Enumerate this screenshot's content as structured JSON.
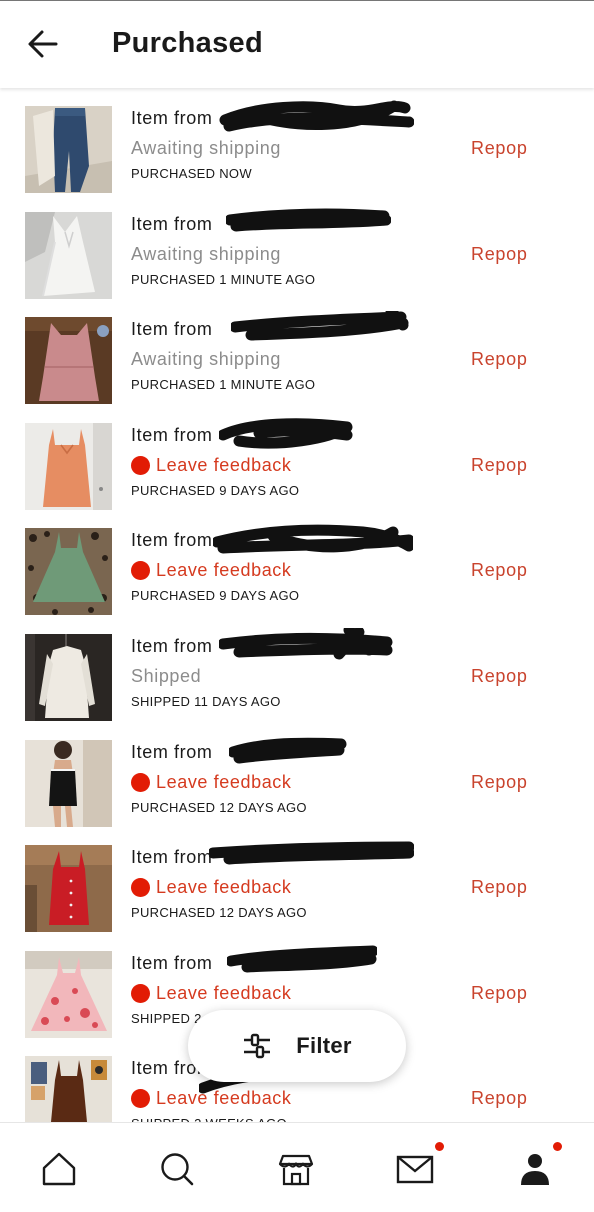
{
  "header": {
    "title": "Purchased",
    "back_icon": "arrow-left-icon"
  },
  "colors": {
    "accent_red": "#d53a1f",
    "repop_red": "#c9432d",
    "status_gray": "#8c8c8c",
    "badge_red": "#e21c05"
  },
  "items": [
    {
      "seller_prefix": "Item from",
      "status": "Awaiting shipping",
      "status_type": "gray",
      "timestamp": "PURCHASED NOW",
      "action": "Repop",
      "thumb": "jeans-thumbnail"
    },
    {
      "seller_prefix": "Item from",
      "status": "Awaiting shipping",
      "status_type": "gray",
      "timestamp": "PURCHASED 1 MINUTE AGO",
      "action": "Repop",
      "thumb": "white-dress-thumbnail"
    },
    {
      "seller_prefix": "Item from",
      "status": "Awaiting shipping",
      "status_type": "gray",
      "timestamp": "PURCHASED 1 MINUTE AGO",
      "action": "Repop",
      "thumb": "pink-dress-thumbnail"
    },
    {
      "seller_prefix": "Item from",
      "status": "Leave feedback",
      "status_type": "red",
      "timestamp": "PURCHASED 9 DAYS AGO",
      "action": "Repop",
      "thumb": "orange-slip-dress-thumbnail"
    },
    {
      "seller_prefix": "Item from",
      "status": "Leave feedback",
      "status_type": "red",
      "timestamp": "PURCHASED 9 DAYS AGO",
      "action": "Repop",
      "thumb": "green-dress-thumbnail"
    },
    {
      "seller_prefix": "Item from",
      "status": "Shipped",
      "status_type": "gray",
      "timestamp": "SHIPPED 11 DAYS AGO",
      "action": "Repop",
      "thumb": "cream-dress-thumbnail"
    },
    {
      "seller_prefix": "Item from",
      "status": "Leave feedback",
      "status_type": "red",
      "timestamp": "PURCHASED 12 DAYS AGO",
      "action": "Repop",
      "thumb": "black-dress-thumbnail"
    },
    {
      "seller_prefix": "Item from",
      "status": "Leave feedback",
      "status_type": "red",
      "timestamp": "PURCHASED 12 DAYS AGO",
      "action": "Repop",
      "thumb": "red-dress-thumbnail"
    },
    {
      "seller_prefix": "Item from",
      "status": "Leave feedback",
      "status_type": "red",
      "timestamp": "SHIPPED 2",
      "action": "Repop",
      "thumb": "floral-dress-thumbnail"
    },
    {
      "seller_prefix": "Item from",
      "status": "Leave feedback",
      "status_type": "red",
      "timestamp": "SHIPPED 2 WEEKS AGO",
      "action": "Repop",
      "thumb": "brown-dress-thumbnail"
    }
  ],
  "filter": {
    "label": "Filter",
    "icon": "sliders-icon"
  },
  "nav": {
    "items": [
      {
        "name": "home",
        "icon": "home-icon",
        "badge": false
      },
      {
        "name": "search",
        "icon": "search-icon",
        "badge": false
      },
      {
        "name": "shop",
        "icon": "storefront-icon",
        "badge": false
      },
      {
        "name": "messages",
        "icon": "envelope-icon",
        "badge": true
      },
      {
        "name": "profile",
        "icon": "person-icon",
        "badge": true
      }
    ]
  }
}
